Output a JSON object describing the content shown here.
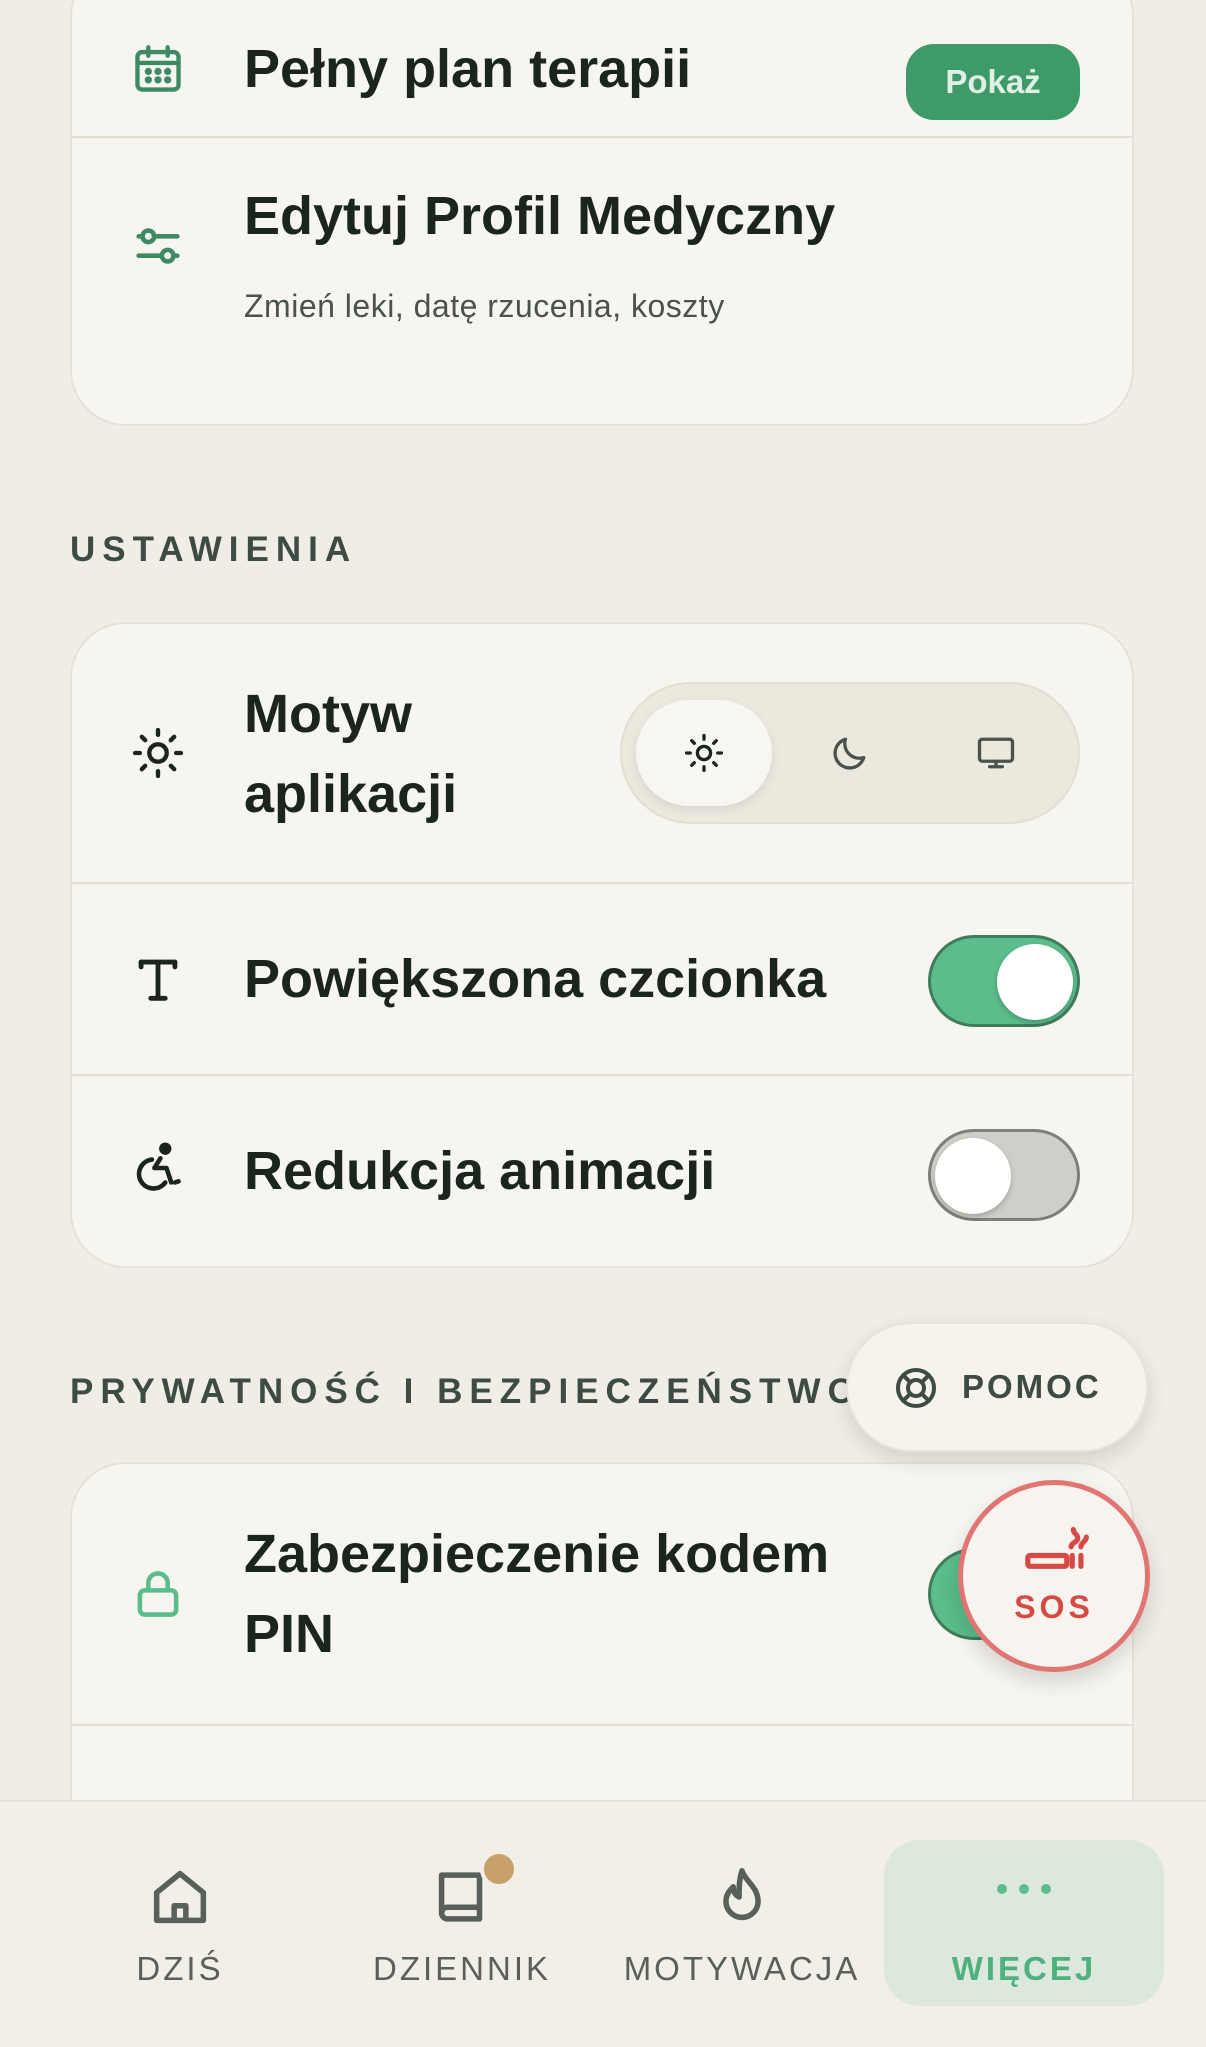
{
  "profile_card": {
    "plan_title": "Pełny plan terapii",
    "plan_button": "Pokaż",
    "edit_title": "Edytuj Profil Medyczny",
    "edit_subtitle": "Zmień leki, datę rzucenia, koszty"
  },
  "settings": {
    "section_label": "USTAWIENIA",
    "theme_title_line1": "Motyw",
    "theme_title_line2": "aplikacji",
    "theme_options": [
      "light",
      "dark",
      "system"
    ],
    "theme_selected": "light",
    "large_font_title": "Powiększona czcionka",
    "large_font_on": true,
    "reduce_motion_title": "Redukcja animacji",
    "reduce_motion_on": false
  },
  "privacy": {
    "section_label": "PRYWATNOŚĆ I BEZPIECZEŃSTWO",
    "pin_title_line1": "Zabezpieczenie kodem",
    "pin_title_line2": "PIN",
    "pin_on": true
  },
  "floating": {
    "help_label": "POMOC",
    "sos_label": "SOS"
  },
  "nav": {
    "items": [
      {
        "label": "DZIŚ",
        "icon": "home-icon"
      },
      {
        "label": "DZIENNIK",
        "icon": "journal-icon",
        "badge": true
      },
      {
        "label": "MOTYWACJA",
        "icon": "flame-icon"
      },
      {
        "label": "WIĘCEJ",
        "icon": "more-icon",
        "active": true
      }
    ]
  },
  "colors": {
    "accent_green": "#3f9a6a",
    "toggle_on": "#5bbd8b",
    "sos_red": "#d64a45",
    "badge": "#c9a06a"
  }
}
